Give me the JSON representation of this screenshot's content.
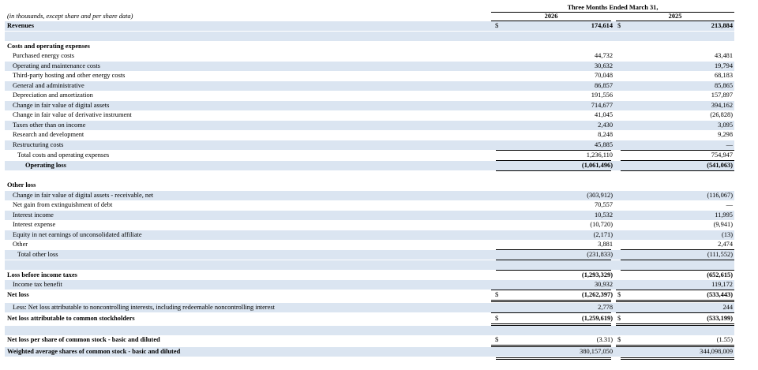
{
  "header": {
    "units_note": "(in thousands, except share and per share data)",
    "period": "Three Months Ended March 31,",
    "year1": "2026",
    "year2": "2025"
  },
  "rows": [
    {
      "label": "Revenues",
      "v1": "174,614",
      "v2": "213,884",
      "d1": "$",
      "d2": "$"
    },
    {
      "label": "Costs and operating expenses"
    },
    {
      "label": "Purchased energy costs",
      "v1": "44,732",
      "v2": "43,481"
    },
    {
      "label": "Operating and maintenance costs",
      "v1": "30,632",
      "v2": "19,794"
    },
    {
      "label": "Third-party hosting and other energy costs",
      "v1": "70,048",
      "v2": "68,183"
    },
    {
      "label": "General and administrative",
      "v1": "86,857",
      "v2": "85,865"
    },
    {
      "label": "Depreciation and amortization",
      "v1": "191,556",
      "v2": "157,897"
    },
    {
      "label": "Change in fair value of digital assets",
      "v1": "714,677",
      "v2": "394,162"
    },
    {
      "label": "Change in fair value of derivative instrument",
      "v1": "41,045",
      "v2": "(26,828)"
    },
    {
      "label": "Taxes other than on income",
      "v1": "2,430",
      "v2": "3,095"
    },
    {
      "label": "Research and development",
      "v1": "8,248",
      "v2": "9,298"
    },
    {
      "label": "Restructuring costs",
      "v1": "45,885",
      "v2": "—"
    },
    {
      "label": "Total costs and operating expenses",
      "v1": "1,236,110",
      "v2": "754,947"
    },
    {
      "label": "Operating loss",
      "v1": "(1,061,496)",
      "v2": "(541,063)"
    },
    {
      "label": "Other loss"
    },
    {
      "label": "Change in fair value of digital assets - receivable, net",
      "v1": "(303,912)",
      "v2": "(116,067)"
    },
    {
      "label": "Net gain from extinguishment of debt",
      "v1": "70,557",
      "v2": "—"
    },
    {
      "label": "Interest income",
      "v1": "10,532",
      "v2": "11,995"
    },
    {
      "label": "Interest expense",
      "v1": "(10,720)",
      "v2": "(9,941)"
    },
    {
      "label": "Equity in net earnings of unconsolidated affiliate",
      "v1": "(2,171)",
      "v2": "(13)"
    },
    {
      "label": "Other",
      "v1": "3,881",
      "v2": "2,474"
    },
    {
      "label": "Total other loss",
      "v1": "(231,833)",
      "v2": "(111,552)"
    },
    {
      "label": "Loss before income taxes",
      "v1": "(1,293,329)",
      "v2": "(652,615)"
    },
    {
      "label": "Income tax benefit",
      "v1": "30,932",
      "v2": "119,172"
    },
    {
      "label": "Net loss",
      "v1": "(1,262,397)",
      "v2": "(533,443)",
      "d1": "$",
      "d2": "$"
    },
    {
      "label": "Less: Net loss attributable to noncontrolling interests, including redeemable noncontrolling interest",
      "v1": "2,778",
      "v2": "244"
    },
    {
      "label": "Net loss attributable to common stockholders",
      "v1": "(1,259,619)",
      "v2": "(533,199)",
      "d1": "$",
      "d2": "$"
    },
    {
      "label": "Net loss per share of common stock - basic and diluted",
      "v1": "(3.31)",
      "v2": "(1.55)",
      "d1": "$",
      "d2": "$"
    },
    {
      "label": "Weighted average shares of common stock - basic and diluted",
      "v1": "380,157,050",
      "v2": "344,098,009"
    }
  ]
}
